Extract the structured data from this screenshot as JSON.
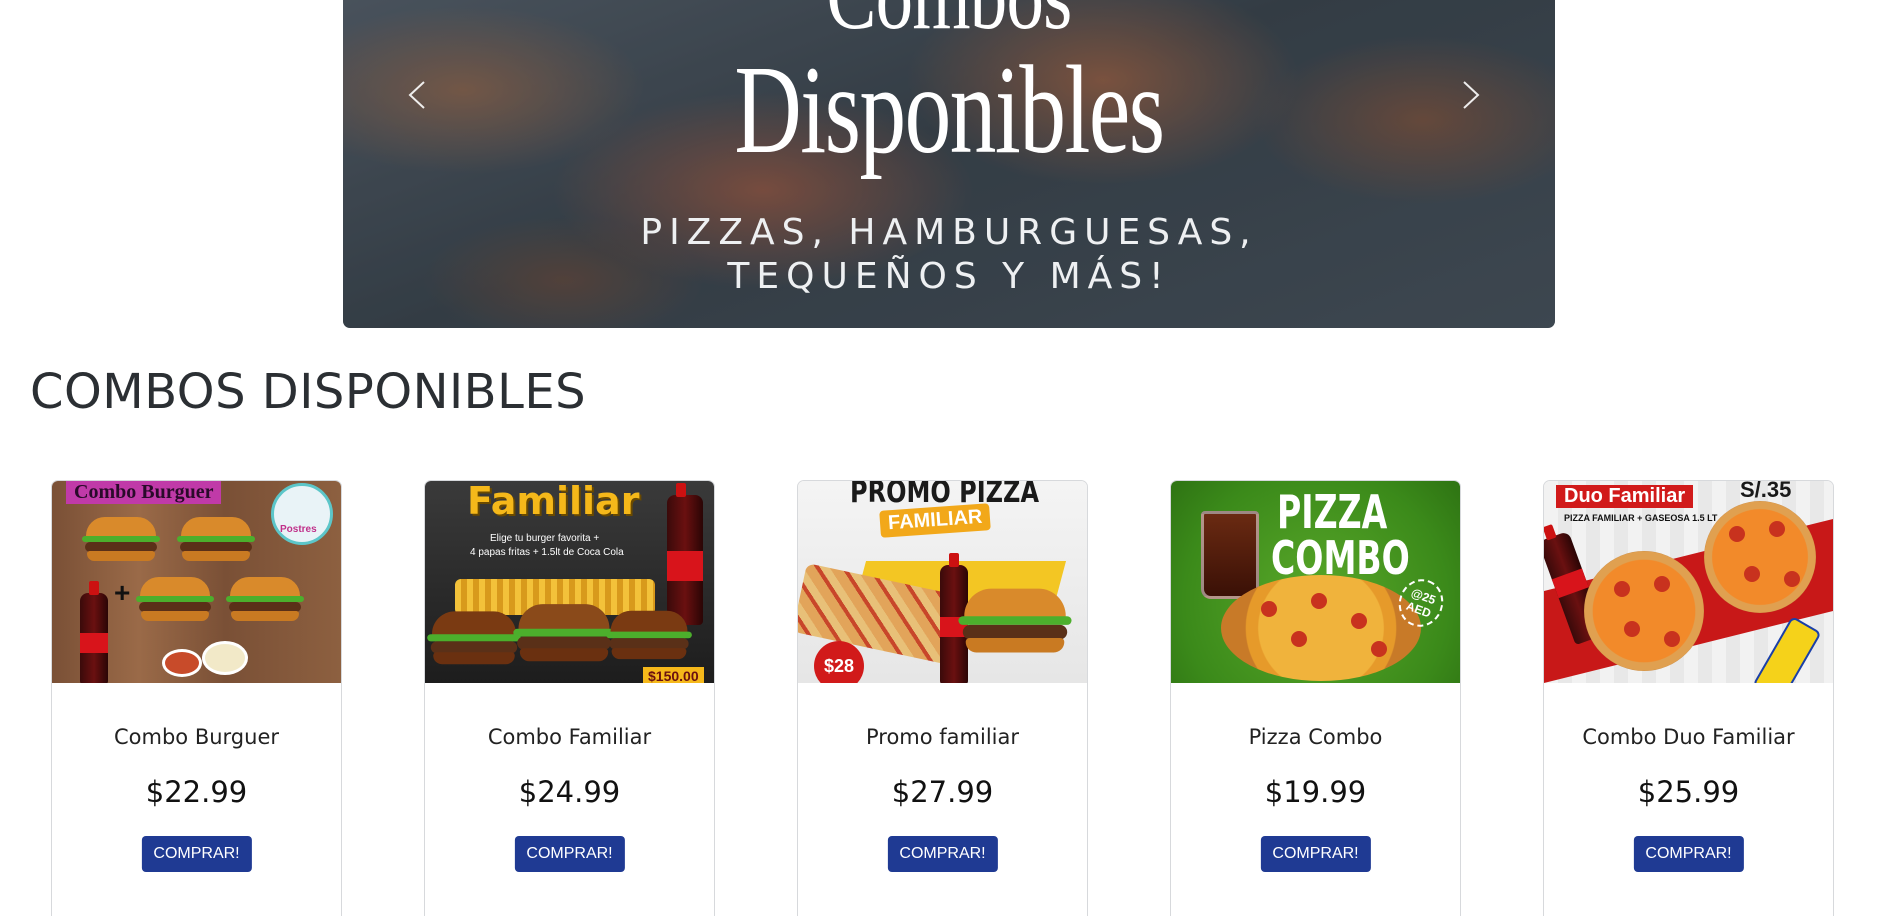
{
  "carousel": {
    "heading_top": "Combos",
    "heading": "Disponibles",
    "subtitle_line1": "PIZZAS, HAMBURGUESAS,",
    "subtitle_line2": "TEQUEÑOS Y MÁS!",
    "prev_icon": "chevron-left-icon",
    "next_icon": "chevron-right-icon"
  },
  "section": {
    "title": "COMBOS DISPONIBLES"
  },
  "products": [
    {
      "name": "Combo Burguer",
      "price": "$22.99",
      "button": "COMPRAR!",
      "image_text": "Combo Burguer",
      "image_badge": "Postres"
    },
    {
      "name": "Combo Familiar",
      "price": "$24.99",
      "button": "COMPRAR!",
      "image_text": "Familiar",
      "image_caption_1": "Elige tu burger favorita +",
      "image_caption_2": "4 papas fritas + 1.5lt de Coca Cola",
      "image_price": "$150.00"
    },
    {
      "name": "Promo familiar",
      "price": "$27.99",
      "button": "COMPRAR!",
      "image_text": "PROMO PIZZA",
      "image_badge": "FAMILIAR",
      "image_price": "$28"
    },
    {
      "name": "Pizza Combo",
      "price": "$19.99",
      "button": "COMPRAR!",
      "image_text_1": "PIZZA",
      "image_text_2": "COMBO",
      "image_price": "@25 AED"
    },
    {
      "name": "Combo Duo Familiar",
      "price": "$25.99",
      "button": "COMPRAR!",
      "image_text": "Duo Familiar",
      "image_caption": "PIZZA FAMILIAR + GASEOSA 1.5 LT",
      "image_price": "S/.35"
    }
  ]
}
